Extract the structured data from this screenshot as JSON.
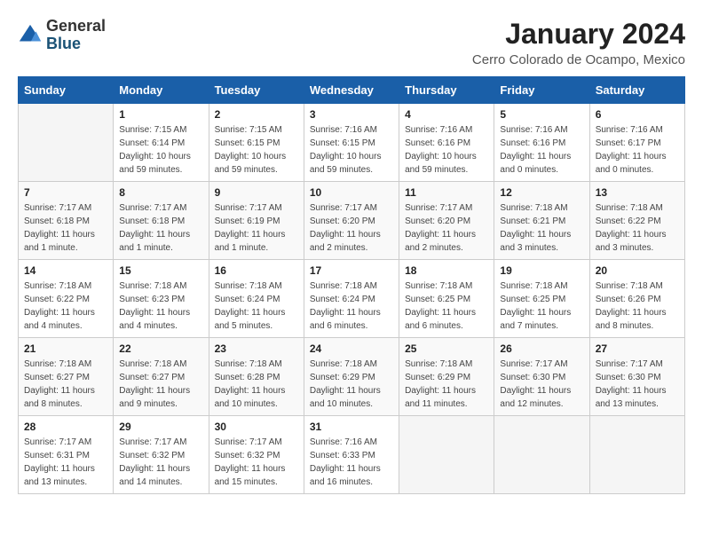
{
  "header": {
    "logo_general": "General",
    "logo_blue": "Blue",
    "title": "January 2024",
    "subtitle": "Cerro Colorado de Ocampo, Mexico"
  },
  "weekdays": [
    "Sunday",
    "Monday",
    "Tuesday",
    "Wednesday",
    "Thursday",
    "Friday",
    "Saturday"
  ],
  "weeks": [
    [
      {
        "day": "",
        "info": ""
      },
      {
        "day": "1",
        "info": "Sunrise: 7:15 AM\nSunset: 6:14 PM\nDaylight: 10 hours\nand 59 minutes."
      },
      {
        "day": "2",
        "info": "Sunrise: 7:15 AM\nSunset: 6:15 PM\nDaylight: 10 hours\nand 59 minutes."
      },
      {
        "day": "3",
        "info": "Sunrise: 7:16 AM\nSunset: 6:15 PM\nDaylight: 10 hours\nand 59 minutes."
      },
      {
        "day": "4",
        "info": "Sunrise: 7:16 AM\nSunset: 6:16 PM\nDaylight: 10 hours\nand 59 minutes."
      },
      {
        "day": "5",
        "info": "Sunrise: 7:16 AM\nSunset: 6:16 PM\nDaylight: 11 hours\nand 0 minutes."
      },
      {
        "day": "6",
        "info": "Sunrise: 7:16 AM\nSunset: 6:17 PM\nDaylight: 11 hours\nand 0 minutes."
      }
    ],
    [
      {
        "day": "7",
        "info": "Sunrise: 7:17 AM\nSunset: 6:18 PM\nDaylight: 11 hours\nand 1 minute."
      },
      {
        "day": "8",
        "info": "Sunrise: 7:17 AM\nSunset: 6:18 PM\nDaylight: 11 hours\nand 1 minute."
      },
      {
        "day": "9",
        "info": "Sunrise: 7:17 AM\nSunset: 6:19 PM\nDaylight: 11 hours\nand 1 minute."
      },
      {
        "day": "10",
        "info": "Sunrise: 7:17 AM\nSunset: 6:20 PM\nDaylight: 11 hours\nand 2 minutes."
      },
      {
        "day": "11",
        "info": "Sunrise: 7:17 AM\nSunset: 6:20 PM\nDaylight: 11 hours\nand 2 minutes."
      },
      {
        "day": "12",
        "info": "Sunrise: 7:18 AM\nSunset: 6:21 PM\nDaylight: 11 hours\nand 3 minutes."
      },
      {
        "day": "13",
        "info": "Sunrise: 7:18 AM\nSunset: 6:22 PM\nDaylight: 11 hours\nand 3 minutes."
      }
    ],
    [
      {
        "day": "14",
        "info": "Sunrise: 7:18 AM\nSunset: 6:22 PM\nDaylight: 11 hours\nand 4 minutes."
      },
      {
        "day": "15",
        "info": "Sunrise: 7:18 AM\nSunset: 6:23 PM\nDaylight: 11 hours\nand 4 minutes."
      },
      {
        "day": "16",
        "info": "Sunrise: 7:18 AM\nSunset: 6:24 PM\nDaylight: 11 hours\nand 5 minutes."
      },
      {
        "day": "17",
        "info": "Sunrise: 7:18 AM\nSunset: 6:24 PM\nDaylight: 11 hours\nand 6 minutes."
      },
      {
        "day": "18",
        "info": "Sunrise: 7:18 AM\nSunset: 6:25 PM\nDaylight: 11 hours\nand 6 minutes."
      },
      {
        "day": "19",
        "info": "Sunrise: 7:18 AM\nSunset: 6:25 PM\nDaylight: 11 hours\nand 7 minutes."
      },
      {
        "day": "20",
        "info": "Sunrise: 7:18 AM\nSunset: 6:26 PM\nDaylight: 11 hours\nand 8 minutes."
      }
    ],
    [
      {
        "day": "21",
        "info": "Sunrise: 7:18 AM\nSunset: 6:27 PM\nDaylight: 11 hours\nand 8 minutes."
      },
      {
        "day": "22",
        "info": "Sunrise: 7:18 AM\nSunset: 6:27 PM\nDaylight: 11 hours\nand 9 minutes."
      },
      {
        "day": "23",
        "info": "Sunrise: 7:18 AM\nSunset: 6:28 PM\nDaylight: 11 hours\nand 10 minutes."
      },
      {
        "day": "24",
        "info": "Sunrise: 7:18 AM\nSunset: 6:29 PM\nDaylight: 11 hours\nand 10 minutes."
      },
      {
        "day": "25",
        "info": "Sunrise: 7:18 AM\nSunset: 6:29 PM\nDaylight: 11 hours\nand 11 minutes."
      },
      {
        "day": "26",
        "info": "Sunrise: 7:17 AM\nSunset: 6:30 PM\nDaylight: 11 hours\nand 12 minutes."
      },
      {
        "day": "27",
        "info": "Sunrise: 7:17 AM\nSunset: 6:30 PM\nDaylight: 11 hours\nand 13 minutes."
      }
    ],
    [
      {
        "day": "28",
        "info": "Sunrise: 7:17 AM\nSunset: 6:31 PM\nDaylight: 11 hours\nand 13 minutes."
      },
      {
        "day": "29",
        "info": "Sunrise: 7:17 AM\nSunset: 6:32 PM\nDaylight: 11 hours\nand 14 minutes."
      },
      {
        "day": "30",
        "info": "Sunrise: 7:17 AM\nSunset: 6:32 PM\nDaylight: 11 hours\nand 15 minutes."
      },
      {
        "day": "31",
        "info": "Sunrise: 7:16 AM\nSunset: 6:33 PM\nDaylight: 11 hours\nand 16 minutes."
      },
      {
        "day": "",
        "info": ""
      },
      {
        "day": "",
        "info": ""
      },
      {
        "day": "",
        "info": ""
      }
    ]
  ]
}
